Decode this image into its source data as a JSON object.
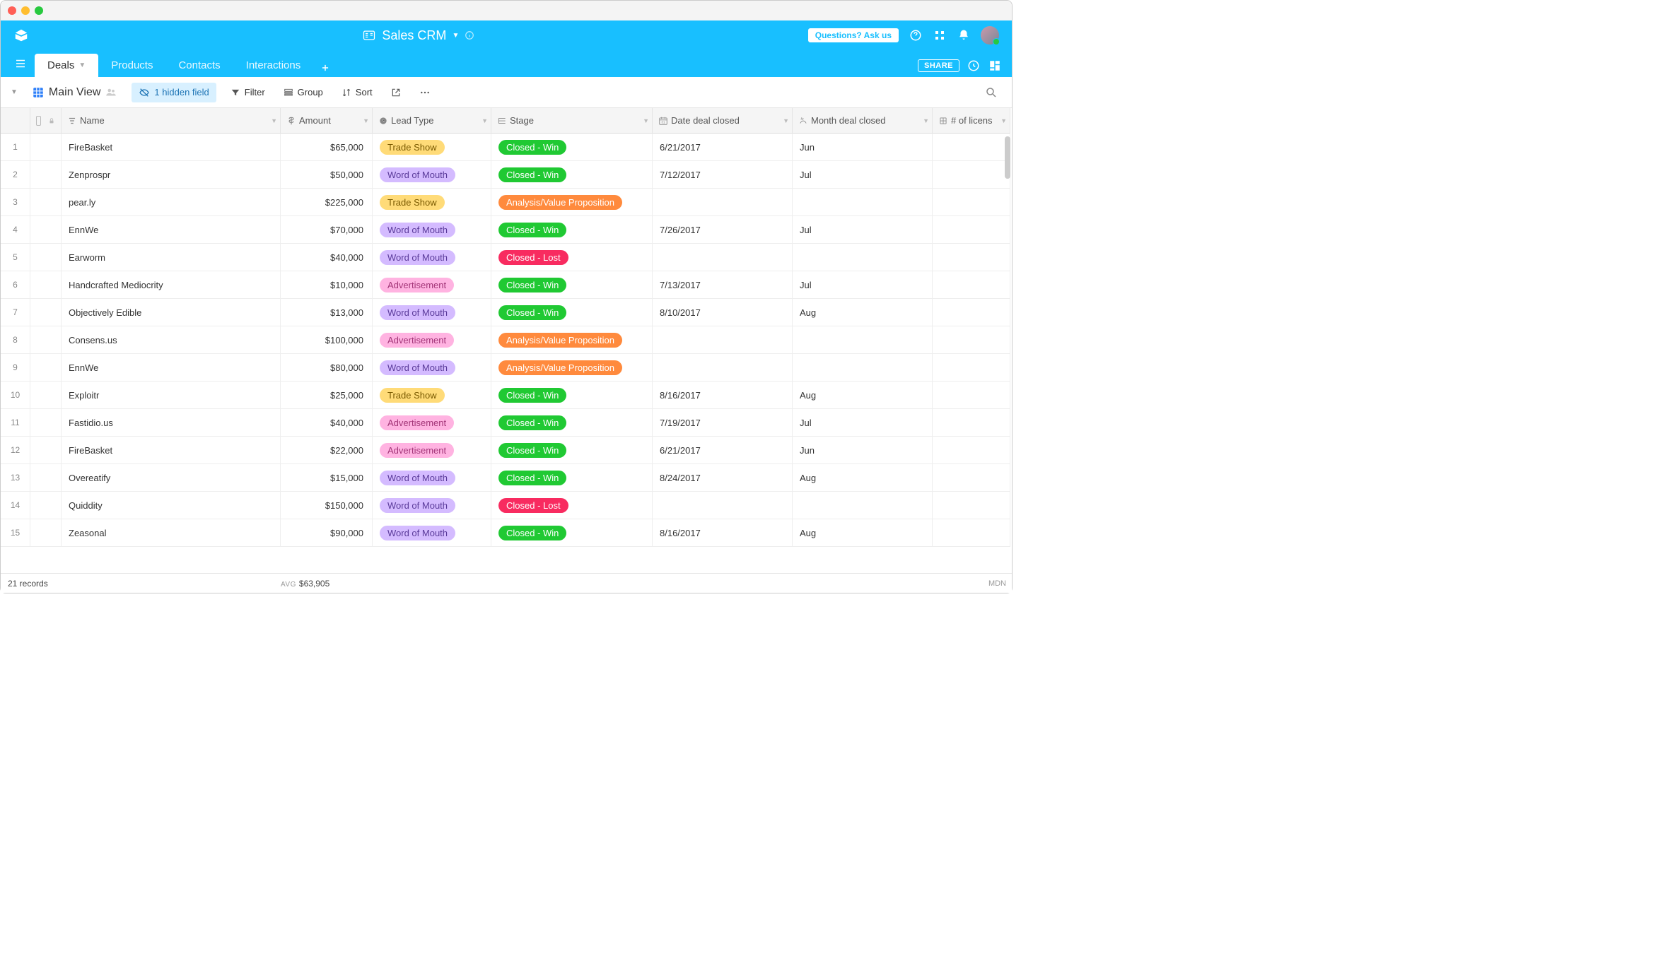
{
  "app_title": "Sales CRM",
  "ask_button": "Questions? Ask us",
  "share_button": "SHARE",
  "tabs": [
    {
      "label": "Deals",
      "active": true
    },
    {
      "label": "Products",
      "active": false
    },
    {
      "label": "Contacts",
      "active": false
    },
    {
      "label": "Interactions",
      "active": false
    }
  ],
  "view_name": "Main View",
  "hidden_fields_label": "1 hidden field",
  "toolbar": {
    "filter": "Filter",
    "group": "Group",
    "sort": "Sort"
  },
  "columns": [
    "Name",
    "Amount",
    "Lead Type",
    "Stage",
    "Date deal closed",
    "Month deal closed",
    "# of licens"
  ],
  "rows": [
    {
      "n": "1",
      "name": "FireBasket",
      "amount": "$65,000",
      "lead": "Trade Show",
      "stage": "Closed - Win",
      "date": "6/21/2017",
      "month": "Jun"
    },
    {
      "n": "2",
      "name": "Zenprospr",
      "amount": "$50,000",
      "lead": "Word of Mouth",
      "stage": "Closed - Win",
      "date": "7/12/2017",
      "month": "Jul"
    },
    {
      "n": "3",
      "name": "pear.ly",
      "amount": "$225,000",
      "lead": "Trade Show",
      "stage": "Analysis/Value Proposition",
      "date": "",
      "month": ""
    },
    {
      "n": "4",
      "name": "EnnWe",
      "amount": "$70,000",
      "lead": "Word of Mouth",
      "stage": "Closed - Win",
      "date": "7/26/2017",
      "month": "Jul"
    },
    {
      "n": "5",
      "name": "Earworm",
      "amount": "$40,000",
      "lead": "Word of Mouth",
      "stage": "Closed - Lost",
      "date": "",
      "month": ""
    },
    {
      "n": "6",
      "name": "Handcrafted Mediocrity",
      "amount": "$10,000",
      "lead": "Advertisement",
      "stage": "Closed - Win",
      "date": "7/13/2017",
      "month": "Jul"
    },
    {
      "n": "7",
      "name": "Objectively Edible",
      "amount": "$13,000",
      "lead": "Word of Mouth",
      "stage": "Closed - Win",
      "date": "8/10/2017",
      "month": "Aug"
    },
    {
      "n": "8",
      "name": "Consens.us",
      "amount": "$100,000",
      "lead": "Advertisement",
      "stage": "Analysis/Value Proposition",
      "date": "",
      "month": ""
    },
    {
      "n": "9",
      "name": "EnnWe",
      "amount": "$80,000",
      "lead": "Word of Mouth",
      "stage": "Analysis/Value Proposition",
      "date": "",
      "month": ""
    },
    {
      "n": "10",
      "name": "Exploitr",
      "amount": "$25,000",
      "lead": "Trade Show",
      "stage": "Closed - Win",
      "date": "8/16/2017",
      "month": "Aug"
    },
    {
      "n": "11",
      "name": "Fastidio.us",
      "amount": "$40,000",
      "lead": "Advertisement",
      "stage": "Closed - Win",
      "date": "7/19/2017",
      "month": "Jul"
    },
    {
      "n": "12",
      "name": "FireBasket",
      "amount": "$22,000",
      "lead": "Advertisement",
      "stage": "Closed - Win",
      "date": "6/21/2017",
      "month": "Jun"
    },
    {
      "n": "13",
      "name": "Overeatify",
      "amount": "$15,000",
      "lead": "Word of Mouth",
      "stage": "Closed - Win",
      "date": "8/24/2017",
      "month": "Aug"
    },
    {
      "n": "14",
      "name": "Quiddity",
      "amount": "$150,000",
      "lead": "Word of Mouth",
      "stage": "Closed - Lost",
      "date": "",
      "month": ""
    },
    {
      "n": "15",
      "name": "Zeasonal",
      "amount": "$90,000",
      "lead": "Word of Mouth",
      "stage": "Closed - Win",
      "date": "8/16/2017",
      "month": "Aug"
    }
  ],
  "record_count": "21 records",
  "avg_label": "AVG",
  "avg_value": "$63,905",
  "footer_right": "MDN",
  "lead_colors": {
    "Trade Show": "pill-trade",
    "Word of Mouth": "pill-wom",
    "Advertisement": "pill-ad"
  },
  "stage_colors": {
    "Closed - Win": "pill-win",
    "Closed - Lost": "pill-lost",
    "Analysis/Value Proposition": "pill-avp"
  }
}
